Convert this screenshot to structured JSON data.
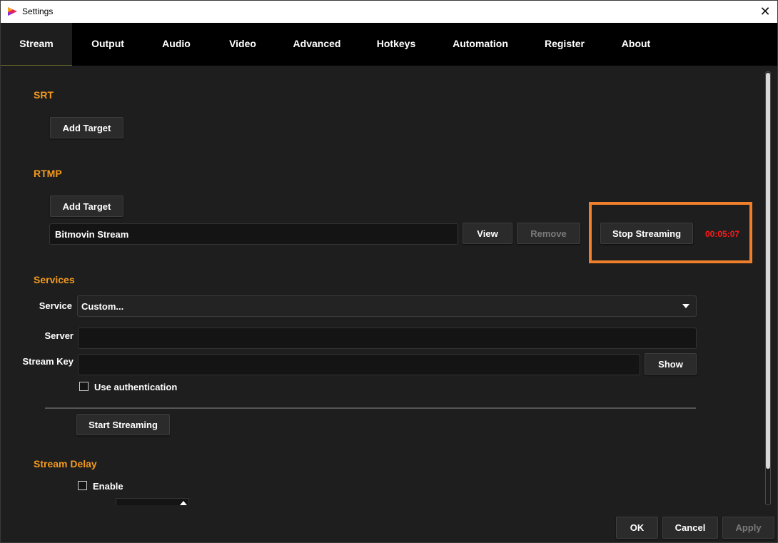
{
  "window": {
    "title": "Settings",
    "close_glyph": "✕"
  },
  "tabs": [
    {
      "label": "Stream",
      "active": true
    },
    {
      "label": "Output"
    },
    {
      "label": "Audio"
    },
    {
      "label": "Video"
    },
    {
      "label": "Advanced"
    },
    {
      "label": "Hotkeys"
    },
    {
      "label": "Automation"
    },
    {
      "label": "Register"
    },
    {
      "label": "About"
    }
  ],
  "srt": {
    "heading": "SRT",
    "add_target": "Add Target"
  },
  "rtmp": {
    "heading": "RTMP",
    "add_target": "Add Target",
    "target_name": "Bitmovin Stream",
    "view": "View",
    "remove": "Remove",
    "stop_streaming": "Stop Streaming",
    "elapsed": "00:05:07"
  },
  "services": {
    "heading": "Services",
    "service_label": "Service",
    "service_value": "Custom...",
    "server_label": "Server",
    "server_value": "",
    "stream_key_label": "Stream Key",
    "stream_key_value": "",
    "show": "Show",
    "use_auth": "Use authentication",
    "start_streaming": "Start Streaming"
  },
  "stream_delay": {
    "heading": "Stream Delay",
    "enable": "Enable"
  },
  "footer": {
    "ok": "OK",
    "cancel": "Cancel",
    "apply": "Apply"
  },
  "colors": {
    "accent": "#f39a1f",
    "highlight": "#ef7f2a",
    "timer": "#ff1a1a"
  }
}
